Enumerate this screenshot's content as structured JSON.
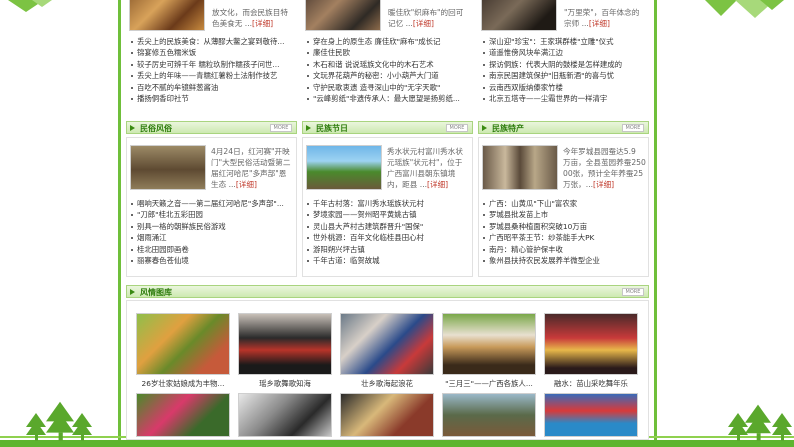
{
  "top_row": {
    "col1": {
      "teaser_line1": "放文化，而会民族目特",
      "teaser_line2": "色美食无 ...",
      "teaser_more": "[详细]",
      "items": [
        "丢尖上的民族美食：从薄醪大鳖之宴到敬待...",
        "锦宴修五色糯米饭",
        "较子厉史可辨千年 糯粒玖制作糯孩子问世...",
        "丢尖上的年味——青糯红薯粉土法制作技艺",
        "百吃不腻的牟镜鲜葱酱油",
        "播扬侗香印社节"
      ]
    },
    "col2": {
      "teaser_line1": "暖佳欣\"织麻布\"的回可",
      "teaser_line2": "记忆 ...",
      "teaser_more": "[详细]",
      "items": [
        "穿在身上的原生态 廉佳欣\"麻布\"成长记",
        "廉佳住民欧",
        "木石和谐 说说瑶族文化中的木石艺术",
        "文玩界花葫芦的秘密：小小葫芦大门道",
        "守护民歌衷遗 造寻深山中的\"无字天歌\"",
        "\"云峰剪纸\"非遗传承人：最大愿望是扬剪纸..."
      ]
    },
    "col3": {
      "teaser_line1": "\"万里荣\"，百年体念的",
      "teaser_line2": "宗师 ...",
      "teaser_more": "[详细]",
      "items": [
        "深山迎\"珍宝\"：王家琪群楼\"立雕\"仪式",
        "道遥惟傍风块牟满江边",
        "探访侗族：代表大阴的鼓楼是怎样建成的",
        "南京民国建筑保护\"旧瓶新酒\"的喜与忧",
        "云南西双版纳傣家竹楼",
        "北京五塔寺——尘霜世界的一样清宇"
      ]
    }
  },
  "sections": {
    "fengsu": {
      "title": "民俗风俗",
      "more": "MORE"
    },
    "jieri": {
      "title": "民族节日",
      "more": "MORE"
    },
    "techan": {
      "title": "民族特产",
      "more": "MORE"
    },
    "gallery": {
      "title": "风情图库",
      "more": "MORE"
    }
  },
  "mid_row": {
    "col1": {
      "teaser_line1": "4月24日，红河赛\"开映",
      "teaser_line2": "门\"大型民俗活动暨第二",
      "teaser_line3": "届红河哈尼\"多声部\"恩",
      "teaser_line4": "生态 ...",
      "teaser_more": "[详细]",
      "items": [
        "唱响天籁之音——第二届红河哈尼\"多声部\"...",
        "\"刀郎\"桂北五彩田园",
        "别具一格的朝鲜族民俗游戏",
        "烟雨涌江",
        "桂北田园即画卷",
        "丽寨春色苍仙境"
      ]
    },
    "col2": {
      "teaser_line1": "秀水状元村富川秀水状",
      "teaser_line2": "元瑶族\"状元村\"，位于",
      "teaser_line3": "广西富川县朝东镇境",
      "teaser_line4": "内，距县 ...",
      "teaser_more": "[详细]",
      "items": [
        "千年古村落：富川秀水瑶族状元村",
        "梦境家园——贺州昭平黄姚古镇",
        "灵山县大芦村古建筑群晋升\"国保\"",
        "世外桃源：百年文化临桂县田心村",
        "游阳朔兴坪古镇",
        "千年古道：临贺故城"
      ]
    },
    "col3": {
      "teaser_line1": "今年罗城县园蚕达5.9",
      "teaser_line2": "万亩，全县茧园养蚕250",
      "teaser_line3": "00张，预计全年养蚕25",
      "teaser_line4": "万张，...",
      "teaser_more": "[详细]",
      "items": [
        "广西：山黄瓜\"下山\"富农家",
        "罗城县批发苗上市",
        "罗城县桑种植面积突破10万亩",
        "广西昭平茶王节：纱茶能手大PK",
        "南丹：精心管护保丰收",
        "象州县扶持农民发展养羊微型企业"
      ]
    }
  },
  "gallery": {
    "row1": [
      {
        "caption": "26岁壮家姑娘成为丰物..."
      },
      {
        "caption": "瑶乡歌舞歌知海"
      },
      {
        "caption": "壮乡歌海起浪花"
      },
      {
        "caption": "\"三月三\"——广西各族人..."
      },
      {
        "caption": "融水：苗山采吃舞年乐"
      }
    ]
  },
  "colors": {
    "accent_green": "#5db52f",
    "section_title": "#2f7d0e",
    "more_link": "#c0392b"
  }
}
